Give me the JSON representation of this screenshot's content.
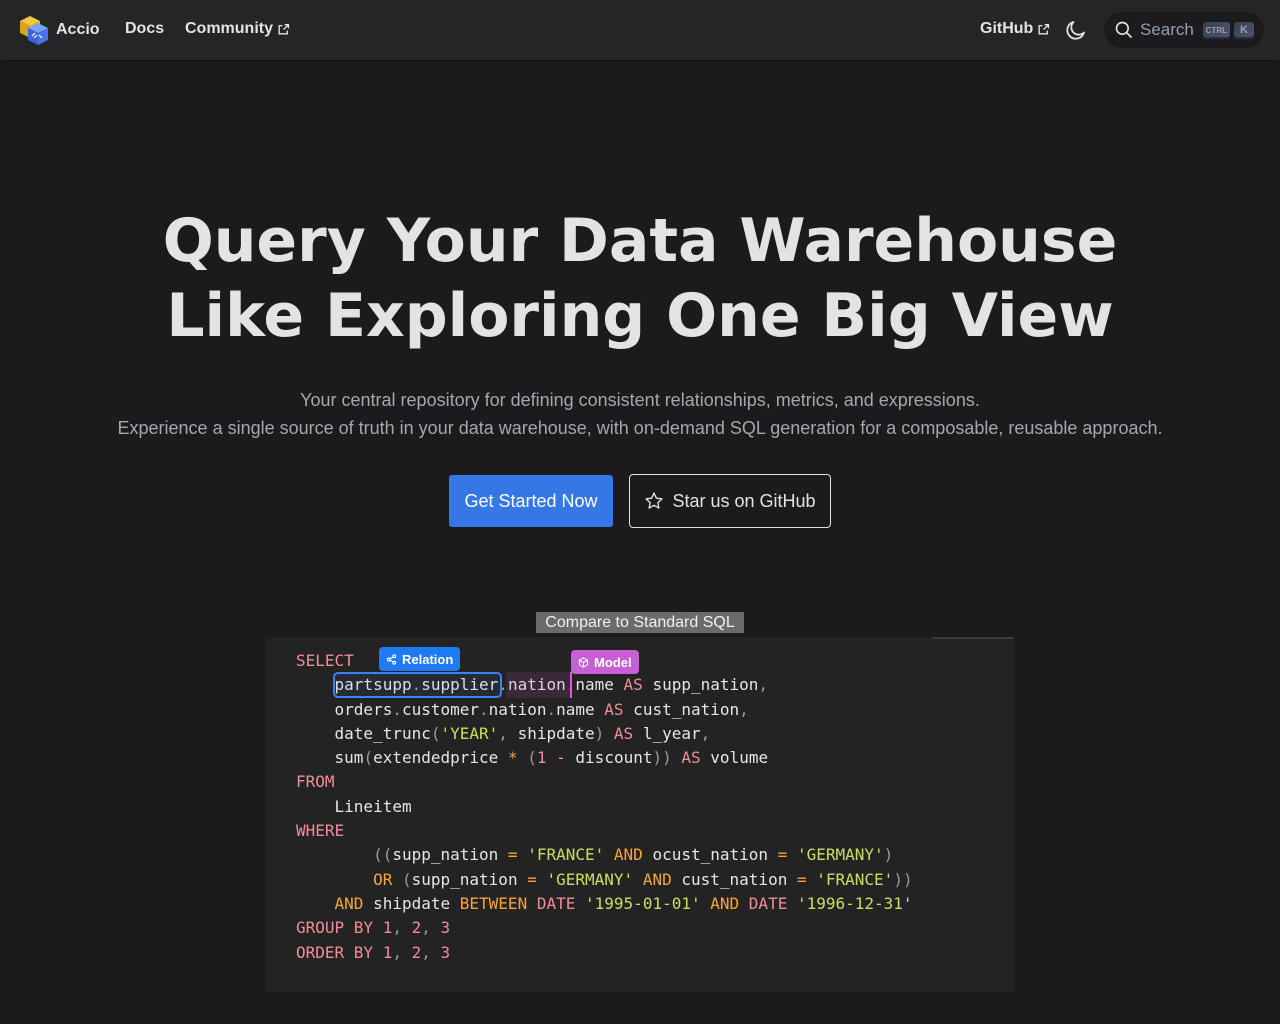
{
  "navbar": {
    "brand": "Accio",
    "links": [
      {
        "label": "Docs"
      },
      {
        "label": "Community"
      },
      {
        "label": "GitHub"
      }
    ],
    "search": {
      "placeholder": "Search",
      "shortcut_ctrl": "CTRL",
      "shortcut_key": "K"
    }
  },
  "hero": {
    "title_line1": "Query Your Data Warehouse",
    "title_line2": "Like Exploring One Big View",
    "subtitle_line1": "Your central repository for defining consistent relationships, metrics, and expressions.",
    "subtitle_line2": "Experience a single source of truth in your data warehouse, with on-demand SQL generation for a composable, reusable approach.",
    "primary_cta": "Get Started Now",
    "secondary_cta": "Star us on GitHub"
  },
  "code_demo": {
    "compare_label": "Compare to Standard SQL",
    "tags": {
      "relation": "Relation",
      "model": "Model"
    }
  },
  "icons": {
    "logo": "accio-cube-logo-icon",
    "external": "external-link-icon",
    "theme": "moon-icon",
    "search": "search-icon",
    "star": "star-icon",
    "relation": "share-nodes-icon",
    "model": "cube-icon"
  },
  "colors": {
    "primary": "#3578e5",
    "relation_tag": "#1e7af5",
    "model_tag": "#c85fd6",
    "background": "#1b1b1d",
    "navbar": "#242526"
  }
}
